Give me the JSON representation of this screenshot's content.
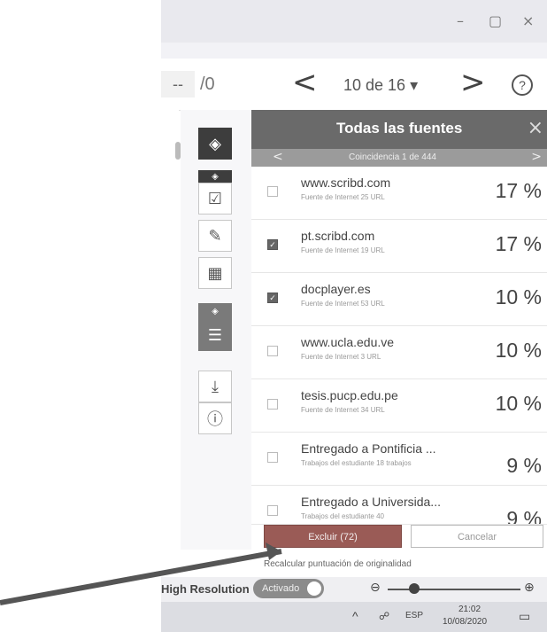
{
  "window": {
    "minimize_glyph": "–",
    "maximize_glyph": "▢",
    "close_glyph": "×"
  },
  "toolbar": {
    "page_input_value": "--",
    "page_total": "/0",
    "prev_glyph": "<",
    "next_glyph": ">",
    "page_selector": "10 de 16 ▾",
    "help_glyph": "?"
  },
  "panel": {
    "title": "Todas las fuentes",
    "close_glyph": "×",
    "prev_glyph": "<",
    "next_glyph": ">",
    "match_text": "Coincidencia 1 de 444",
    "sources": [
      {
        "name": "www.scribd.com",
        "type": "Fuente de Internet  25 URL",
        "percent": "17 %",
        "checked": false
      },
      {
        "name": "pt.scribd.com",
        "type": "Fuente de Internet  19 URL",
        "percent": "17 %",
        "checked": true
      },
      {
        "name": "docplayer.es",
        "type": "Fuente de Internet  53 URL",
        "percent": "10 %",
        "checked": true
      },
      {
        "name": "www.ucla.edu.ve",
        "type": "Fuente de Internet  3 URL",
        "percent": "10 %",
        "checked": false
      },
      {
        "name": "tesis.pucp.edu.pe",
        "type": "Fuente de Internet  34 URL",
        "percent": "10 %",
        "checked": false
      },
      {
        "name": "Entregado a Pontificia ...",
        "type": "Trabajos del estudiante  18 trabajos",
        "percent": "9 %",
        "checked": false
      },
      {
        "name": "Entregado a Universida...",
        "type": "Trabajos del estudiante  40",
        "percent": "9 %",
        "checked": false
      }
    ],
    "exclude_label": "Excluir (72)",
    "cancel_label": "Cancelar",
    "recalc_label": "Recalcular puntuación de originalidad"
  },
  "bottom": {
    "high_resolution_label": "High Resolution",
    "toggle_label": "Activado",
    "toggle_on": true,
    "zoom_level": 0.2,
    "zoom_out_glyph": "⊖",
    "zoom_in_glyph": "⊕"
  },
  "taskbar": {
    "chevron": "^",
    "language": "ESP",
    "time": "21:02",
    "date": "10/08/2020"
  },
  "colors": {
    "panel_header": "#6a6a6a",
    "exclude_button": "#9a5b56",
    "arrow": "#555555"
  }
}
